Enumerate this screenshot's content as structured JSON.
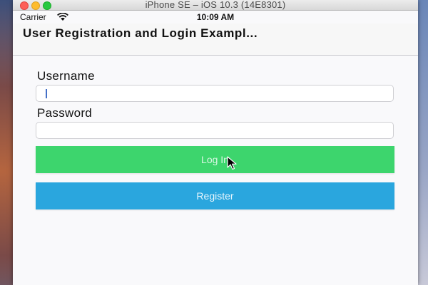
{
  "simulator": {
    "window_title": "iPhone SE – iOS 10.3 (14E8301)"
  },
  "status_bar": {
    "carrier": "Carrier",
    "time": "10:09 AM"
  },
  "nav": {
    "title": "User Registration and Login Exampl..."
  },
  "form": {
    "username_label": "Username",
    "username_value": "",
    "password_label": "Password",
    "password_value": ""
  },
  "buttons": {
    "login_label": "Log In",
    "register_label": "Register"
  },
  "colors": {
    "login_button": "#3dd56d",
    "register_button": "#2aa6de",
    "caret": "#4470c7"
  },
  "icons": [
    "wifi-icon",
    "mouse-pointer-icon"
  ]
}
